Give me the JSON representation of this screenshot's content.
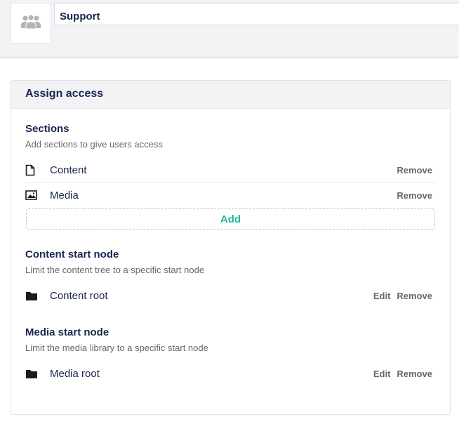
{
  "group": {
    "name": "Support",
    "avatar_icon": "users-icon"
  },
  "assign_access": {
    "title": "Assign access",
    "sections": {
      "title": "Sections",
      "description": "Add sections to give users access",
      "items": [
        {
          "label": "Content",
          "icon": "document-icon",
          "remove_label": "Remove"
        },
        {
          "label": "Media",
          "icon": "image-icon",
          "remove_label": "Remove"
        }
      ],
      "add_label": "Add"
    },
    "content_start_node": {
      "title": "Content start node",
      "description": "Limit the content tree to a specific start node",
      "item": {
        "label": "Content root",
        "icon": "folder-icon",
        "edit_label": "Edit",
        "remove_label": "Remove"
      }
    },
    "media_start_node": {
      "title": "Media start node",
      "description": "Limit the media library to a specific start node",
      "item": {
        "label": "Media root",
        "icon": "folder-icon",
        "edit_label": "Edit",
        "remove_label": "Remove"
      }
    }
  },
  "colors": {
    "accent": "#1fb6a0",
    "text": "#1b264f",
    "muted": "#68676b",
    "header_bg": "#f3f3f5"
  }
}
